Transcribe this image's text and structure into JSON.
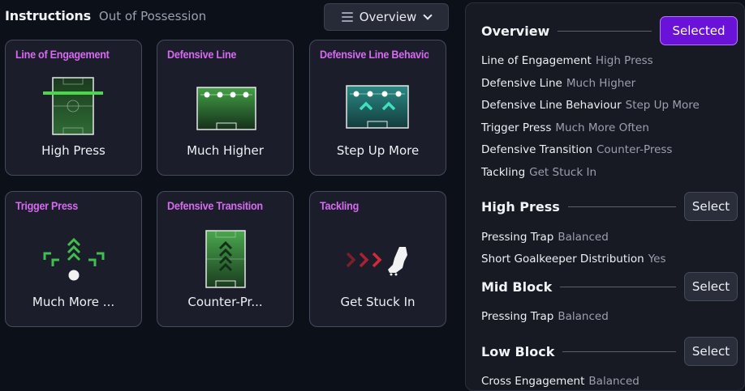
{
  "header": {
    "title": "Instructions",
    "subtitle": "Out of Possession"
  },
  "view_dropdown": {
    "value": "Overview"
  },
  "cards": [
    {
      "title": "Line of Engagement",
      "value": "High Press"
    },
    {
      "title": "Defensive Line",
      "value": "Much Higher"
    },
    {
      "title": "Defensive Line Behaviour",
      "value": "Step Up More"
    },
    {
      "title": "Trigger Press",
      "value": "Much More ..."
    },
    {
      "title": "Defensive Transition",
      "value": "Counter-Pr..."
    },
    {
      "title": "Tackling",
      "value": "Get Stuck In"
    }
  ],
  "panel": {
    "overview": {
      "title": "Overview",
      "button": "Selected",
      "rows": [
        {
          "k": "Line of Engagement",
          "v": "High Press"
        },
        {
          "k": "Defensive Line",
          "v": "Much Higher"
        },
        {
          "k": "Defensive Line Behaviour",
          "v": "Step Up More"
        },
        {
          "k": "Trigger Press",
          "v": "Much More Often"
        },
        {
          "k": "Defensive Transition",
          "v": "Counter-Press"
        },
        {
          "k": "Tackling",
          "v": "Get Stuck In"
        }
      ]
    },
    "high_press": {
      "title": "High Press",
      "button": "Select",
      "rows": [
        {
          "k": "Pressing Trap",
          "v": "Balanced"
        },
        {
          "k": "Short Goalkeeper Distribution",
          "v": "Yes"
        }
      ]
    },
    "mid_block": {
      "title": "Mid Block",
      "button": "Select",
      "rows": [
        {
          "k": "Pressing Trap",
          "v": "Balanced"
        }
      ]
    },
    "low_block": {
      "title": "Low Block",
      "button": "Select",
      "rows": [
        {
          "k": "Cross Engagement",
          "v": "Balanced"
        }
      ]
    }
  },
  "colors": {
    "accent_purple": "#6b12d8",
    "card_title": "#d76bf0",
    "pitch_green": "#2f6b35",
    "arrow_green": "#3fbf4b",
    "arrow_red": "#d22a3a",
    "teal_pitch": "#1f6a6a",
    "chevron_cyan": "#3fe0c0"
  },
  "icons": [
    "list-icon",
    "chevron-down-icon",
    "pitch-line-icon",
    "pitch-high-line-icon",
    "pitch-step-up-icon",
    "press-arrows-icon",
    "pitch-transition-icon",
    "tackle-boot-icon"
  ]
}
